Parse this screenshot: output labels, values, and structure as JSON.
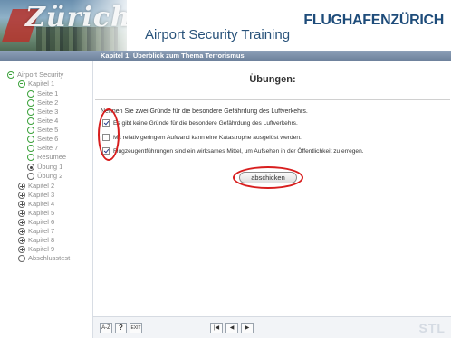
{
  "header": {
    "logo_city": "Zürich",
    "app_title": "Airport Security Training",
    "brand_part1": "FLUGHAFEN",
    "brand_part2": "ZÜRICH"
  },
  "chapter_bar": {
    "title": "Kapitel 1: Überblick zum Thema Terrorismus"
  },
  "sidebar": {
    "items": [
      {
        "label": "Airport Security",
        "icon": "green-minus-icon",
        "state": "expanded"
      },
      {
        "label": "Kapitel 1",
        "icon": "green-minus-icon",
        "state": "expanded"
      },
      {
        "label": "Seite 1",
        "icon": "green-circle-icon",
        "state": "visited"
      },
      {
        "label": "Seite 2",
        "icon": "green-circle-icon",
        "state": "visited"
      },
      {
        "label": "Seite 3",
        "icon": "green-circle-icon",
        "state": "visited"
      },
      {
        "label": "Seite 4",
        "icon": "green-circle-icon",
        "state": "visited"
      },
      {
        "label": "Seite 5",
        "icon": "green-circle-icon",
        "state": "visited"
      },
      {
        "label": "Seite 6",
        "icon": "green-circle-icon",
        "state": "visited"
      },
      {
        "label": "Seite 7",
        "icon": "green-circle-icon",
        "state": "visited"
      },
      {
        "label": "Resümee",
        "icon": "green-circle-icon",
        "state": "visited"
      },
      {
        "label": "Übung 1",
        "icon": "radio-selected-icon",
        "state": "current"
      },
      {
        "label": "Übung 2",
        "icon": "radio-empty-icon",
        "state": "unvisited"
      },
      {
        "label": "Kapitel 2",
        "icon": "plus-icon",
        "state": "collapsed"
      },
      {
        "label": "Kapitel 3",
        "icon": "plus-icon",
        "state": "collapsed"
      },
      {
        "label": "Kapitel 4",
        "icon": "plus-icon",
        "state": "collapsed"
      },
      {
        "label": "Kapitel 5",
        "icon": "plus-icon",
        "state": "collapsed"
      },
      {
        "label": "Kapitel 6",
        "icon": "plus-icon",
        "state": "collapsed"
      },
      {
        "label": "Kapitel 7",
        "icon": "plus-icon",
        "state": "collapsed"
      },
      {
        "label": "Kapitel 8",
        "icon": "plus-icon",
        "state": "collapsed"
      },
      {
        "label": "Kapitel 9",
        "icon": "plus-icon",
        "state": "collapsed"
      },
      {
        "label": "Abschlusstest",
        "icon": "radio-empty-icon",
        "state": "unvisited"
      }
    ]
  },
  "exercise": {
    "heading": "Übungen:",
    "question": "Nennen Sie zwei Gründe für die besondere Gefährdung des Luftverkehrs.",
    "answers": [
      {
        "text": "Es gibt keine Gründe für die besondere Gefährdung des Luftverkehrs.",
        "checked": true
      },
      {
        "text": "Mit relativ geringem Aufwand kann eine Katastrophe ausgelöst werden.",
        "checked": false
      },
      {
        "text": "Flugzeugentführungen sind ein wirksames Mittel, um Aufsehen in der Öffentlichkeit zu erregen.",
        "checked": true
      }
    ],
    "submit_label": "abschicken"
  },
  "toolbar": {
    "az_label": "A-Z",
    "help_label": "?",
    "exit_label": "EXIT",
    "first_label": "|◀",
    "prev_label": "◀",
    "next_label": "▶",
    "logo": "STL"
  },
  "colors": {
    "accent_blue": "#28527a",
    "chapter_bar": "#7488a2",
    "nav_green": "#3aa13a",
    "annotation_red": "#d81e1e"
  }
}
